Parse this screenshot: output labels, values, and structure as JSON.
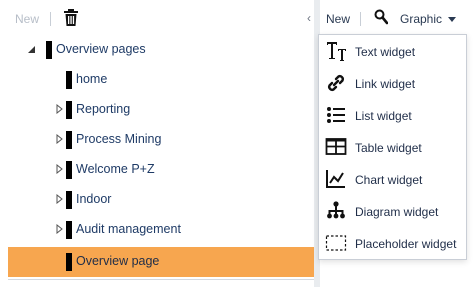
{
  "left_toolbar": {
    "new_label": "New",
    "delete_icon": "trash-icon"
  },
  "tree": [
    {
      "label": "Overview pages",
      "level": 0,
      "expander": "expanded",
      "selected": false
    },
    {
      "label": "home",
      "level": 1,
      "expander": "none",
      "selected": false
    },
    {
      "label": "Reporting",
      "level": 1,
      "expander": "collapsed",
      "selected": false
    },
    {
      "label": "Process Mining",
      "level": 1,
      "expander": "collapsed",
      "selected": false
    },
    {
      "label": "Welcome P+Z",
      "level": 1,
      "expander": "collapsed",
      "selected": false
    },
    {
      "label": "Indoor",
      "level": 1,
      "expander": "collapsed",
      "selected": false
    },
    {
      "label": "Audit management",
      "level": 1,
      "expander": "collapsed",
      "selected": false
    },
    {
      "label": "Overview page",
      "level": 1,
      "expander": "none",
      "selected": true
    }
  ],
  "right_toolbar": {
    "new_label": "New",
    "zoom_icon": "magnifier-icon",
    "dropdown_label": "Graphic"
  },
  "menu": {
    "items": [
      {
        "label": "Text widget",
        "icon": "text-icon"
      },
      {
        "label": "Link widget",
        "icon": "link-icon"
      },
      {
        "label": "List widget",
        "icon": "list-icon"
      },
      {
        "label": "Table widget",
        "icon": "table-icon"
      },
      {
        "label": "Chart widget",
        "icon": "chart-icon"
      },
      {
        "label": "Diagram widget",
        "icon": "diagram-icon"
      },
      {
        "label": "Placeholder widget",
        "icon": "placeholder-icon"
      }
    ]
  },
  "colors": {
    "selection": "#f7a64f",
    "text": "#1f3b66",
    "disabled": "#b7bec8"
  }
}
